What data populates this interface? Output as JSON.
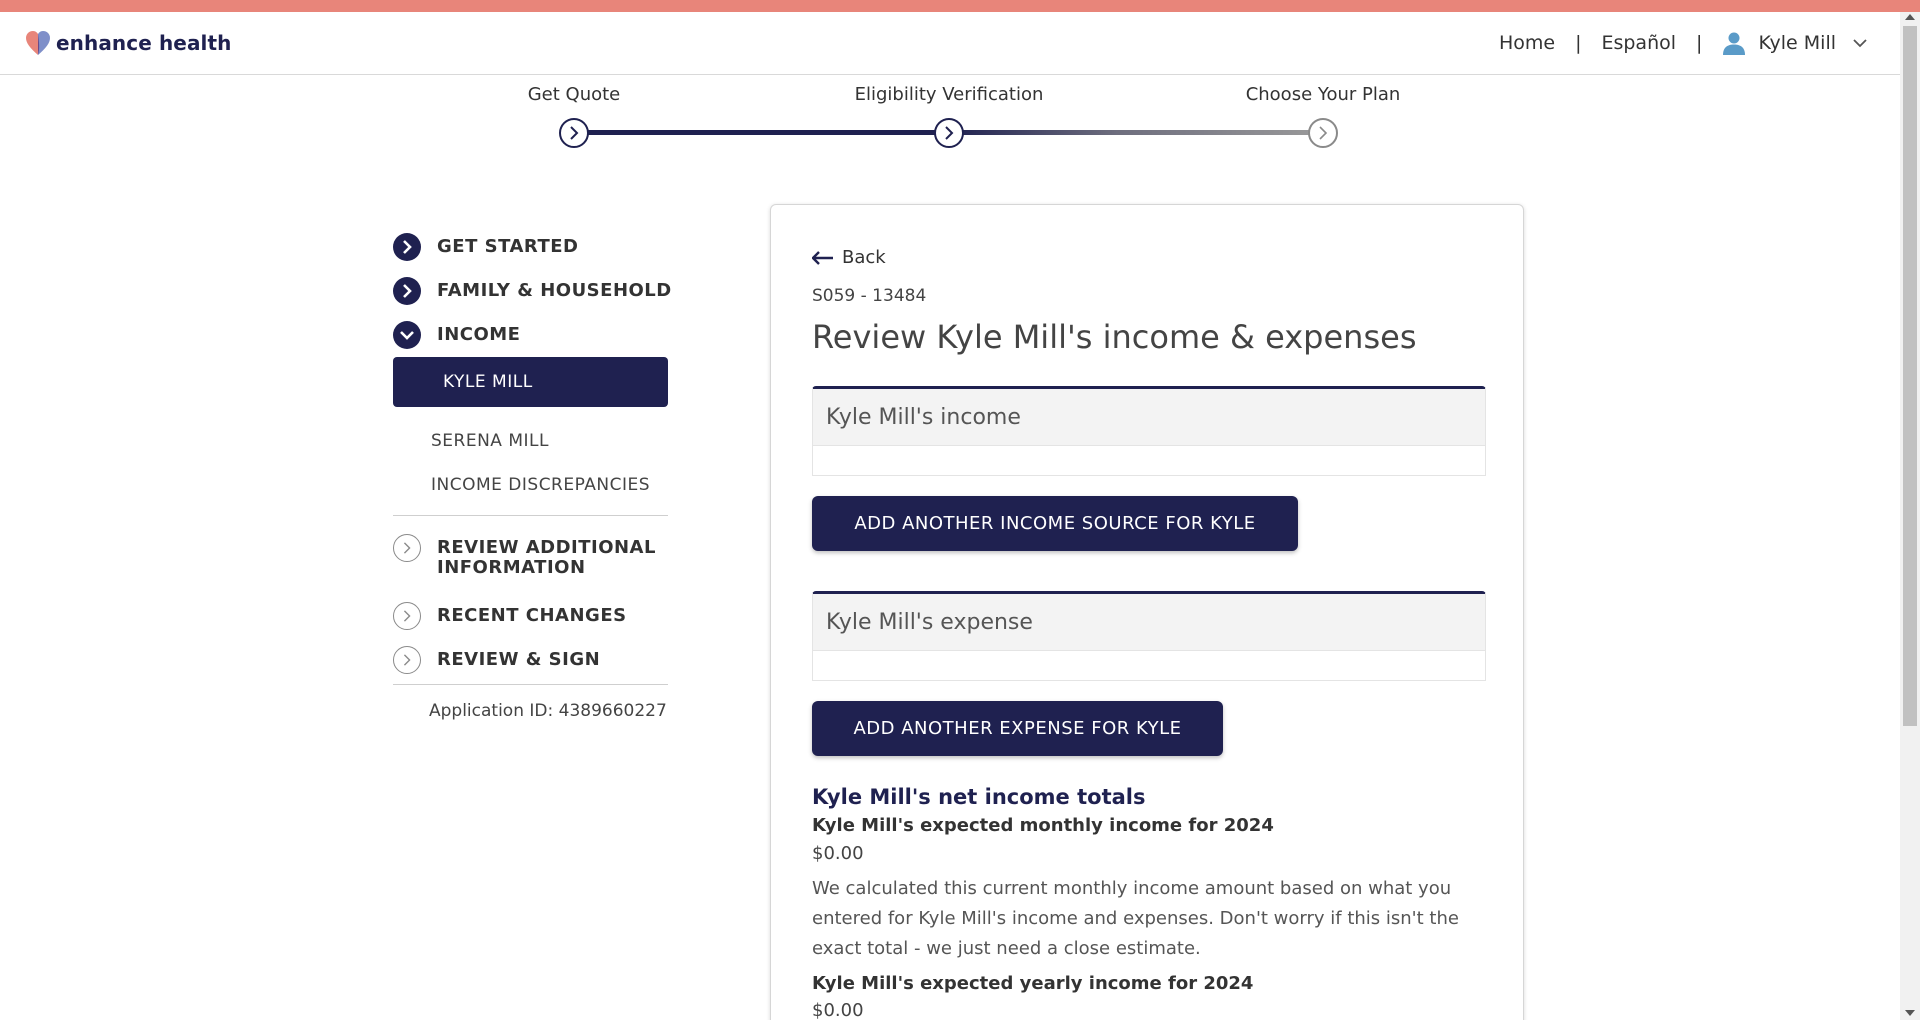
{
  "brand": {
    "name": "enhance health",
    "stripe_color": "#e8857a",
    "primary_color": "#1f2150"
  },
  "header": {
    "nav": {
      "home": "Home",
      "language": "Español",
      "user_name": "Kyle Mill",
      "separator": "|"
    }
  },
  "progress": {
    "steps": [
      {
        "label": "Get Quote",
        "status": "complete"
      },
      {
        "label": "Eligibility Verification",
        "status": "current"
      },
      {
        "label": "Choose Your Plan",
        "status": "upcoming"
      }
    ]
  },
  "sidebar": {
    "items": [
      {
        "label": "GET STARTED",
        "icon": "chevron-right-icon",
        "state": "complete"
      },
      {
        "label": "FAMILY & HOUSEHOLD",
        "icon": "chevron-right-icon",
        "state": "complete"
      },
      {
        "label": "INCOME",
        "icon": "chevron-down-icon",
        "state": "expanded"
      }
    ],
    "sub_items": [
      {
        "label": "KYLE MILL",
        "active": true
      },
      {
        "label": "SERENA MILL",
        "active": false
      },
      {
        "label": "INCOME DISCREPANCIES",
        "active": false
      }
    ],
    "later_items": [
      {
        "label": "REVIEW ADDITIONAL INFORMATION",
        "icon": "chevron-right-outline-icon"
      },
      {
        "label": "RECENT CHANGES",
        "icon": "chevron-right-outline-icon"
      },
      {
        "label": "REVIEW & SIGN",
        "icon": "chevron-right-outline-icon"
      }
    ],
    "application_id": "Application ID: 4389660227"
  },
  "main": {
    "back_label": "Back",
    "case_id": "S059 - 13484",
    "title": "Review Kyle Mill's income & expenses",
    "income_panel_title": "Kyle Mill's income",
    "add_income_button": "ADD ANOTHER INCOME SOURCE FOR KYLE",
    "expense_panel_title": "Kyle Mill's expense",
    "add_expense_button": "ADD ANOTHER EXPENSE FOR KYLE",
    "totals_title": "Kyle Mill's net income totals",
    "monthly_label": "Kyle Mill's expected monthly income for 2024",
    "monthly_amount": "$0.00",
    "explanation": "We calculated this current monthly income amount based on what you entered for Kyle Mill's income and expenses. Don't worry if this isn't the exact total - we just need a close estimate.",
    "yearly_label": "Kyle Mill's expected yearly income for 2024",
    "yearly_amount": "$0.00"
  }
}
